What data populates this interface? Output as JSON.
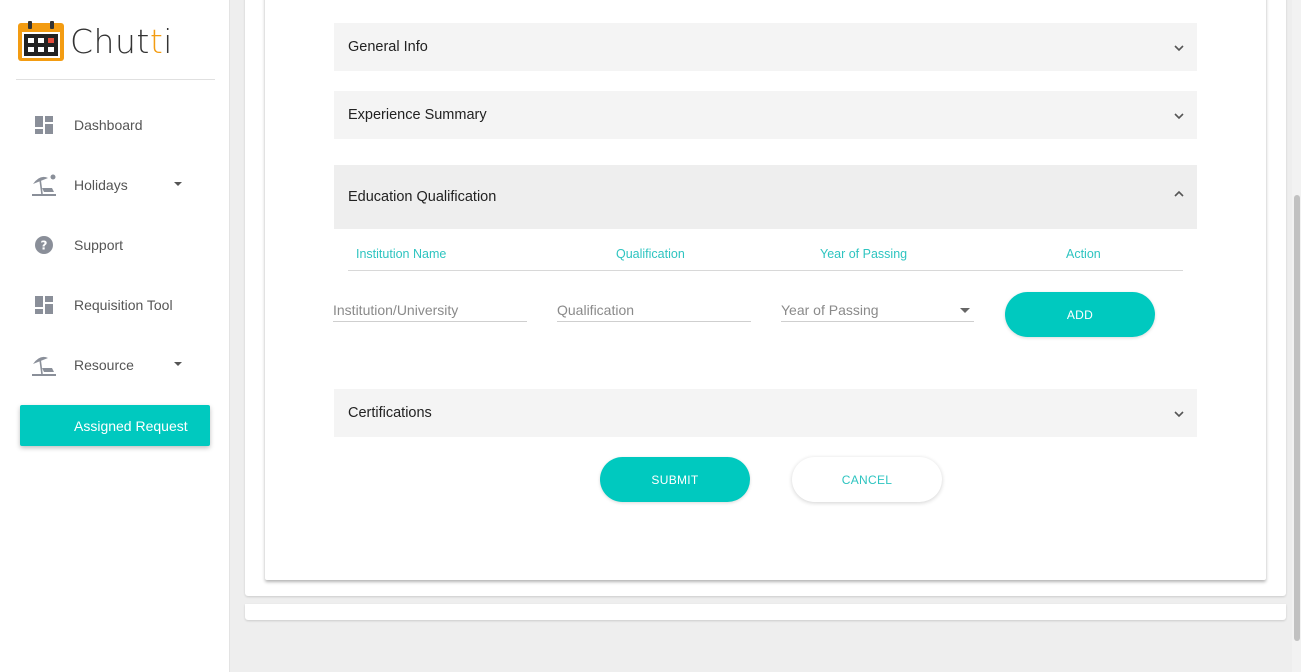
{
  "brand": {
    "name_main": "Chut",
    "name_accent": "t",
    "name_tail": "i",
    "icon": "calendar-logo-icon",
    "accent_color": "#f39c12"
  },
  "sidebar": {
    "items": [
      {
        "label": "Dashboard",
        "icon": "dashboard-icon",
        "has_caret": false
      },
      {
        "label": "Holidays",
        "icon": "beach-icon",
        "has_caret": true
      },
      {
        "label": "Support",
        "icon": "help-icon",
        "has_caret": false
      },
      {
        "label": "Requisition Tool",
        "icon": "dashboard-icon",
        "has_caret": false
      },
      {
        "label": "Resource",
        "icon": "beach-icon",
        "has_caret": true
      }
    ],
    "active_item": {
      "label": "Assigned Request",
      "color": "#00c9bf"
    }
  },
  "form": {
    "panels": [
      {
        "title": "General Info",
        "expanded": false
      },
      {
        "title": "Experience Summary",
        "expanded": false
      },
      {
        "title": "Education Qualification",
        "expanded": true
      },
      {
        "title": "Certifications",
        "expanded": false
      }
    ],
    "education_table": {
      "columns": [
        "Institution Name",
        "Qualification",
        "Year of Passing",
        "Action"
      ]
    },
    "inputs": {
      "institution_placeholder": "Institution/University",
      "qualification_placeholder": "Qualification",
      "year_placeholder": "Year of Passing"
    },
    "add_label": "ADD",
    "submit_label": "SUBMIT",
    "cancel_label": "CANCEL"
  },
  "colors": {
    "primary": "#00c9bf",
    "panel_bg": "#f4f4f4"
  }
}
